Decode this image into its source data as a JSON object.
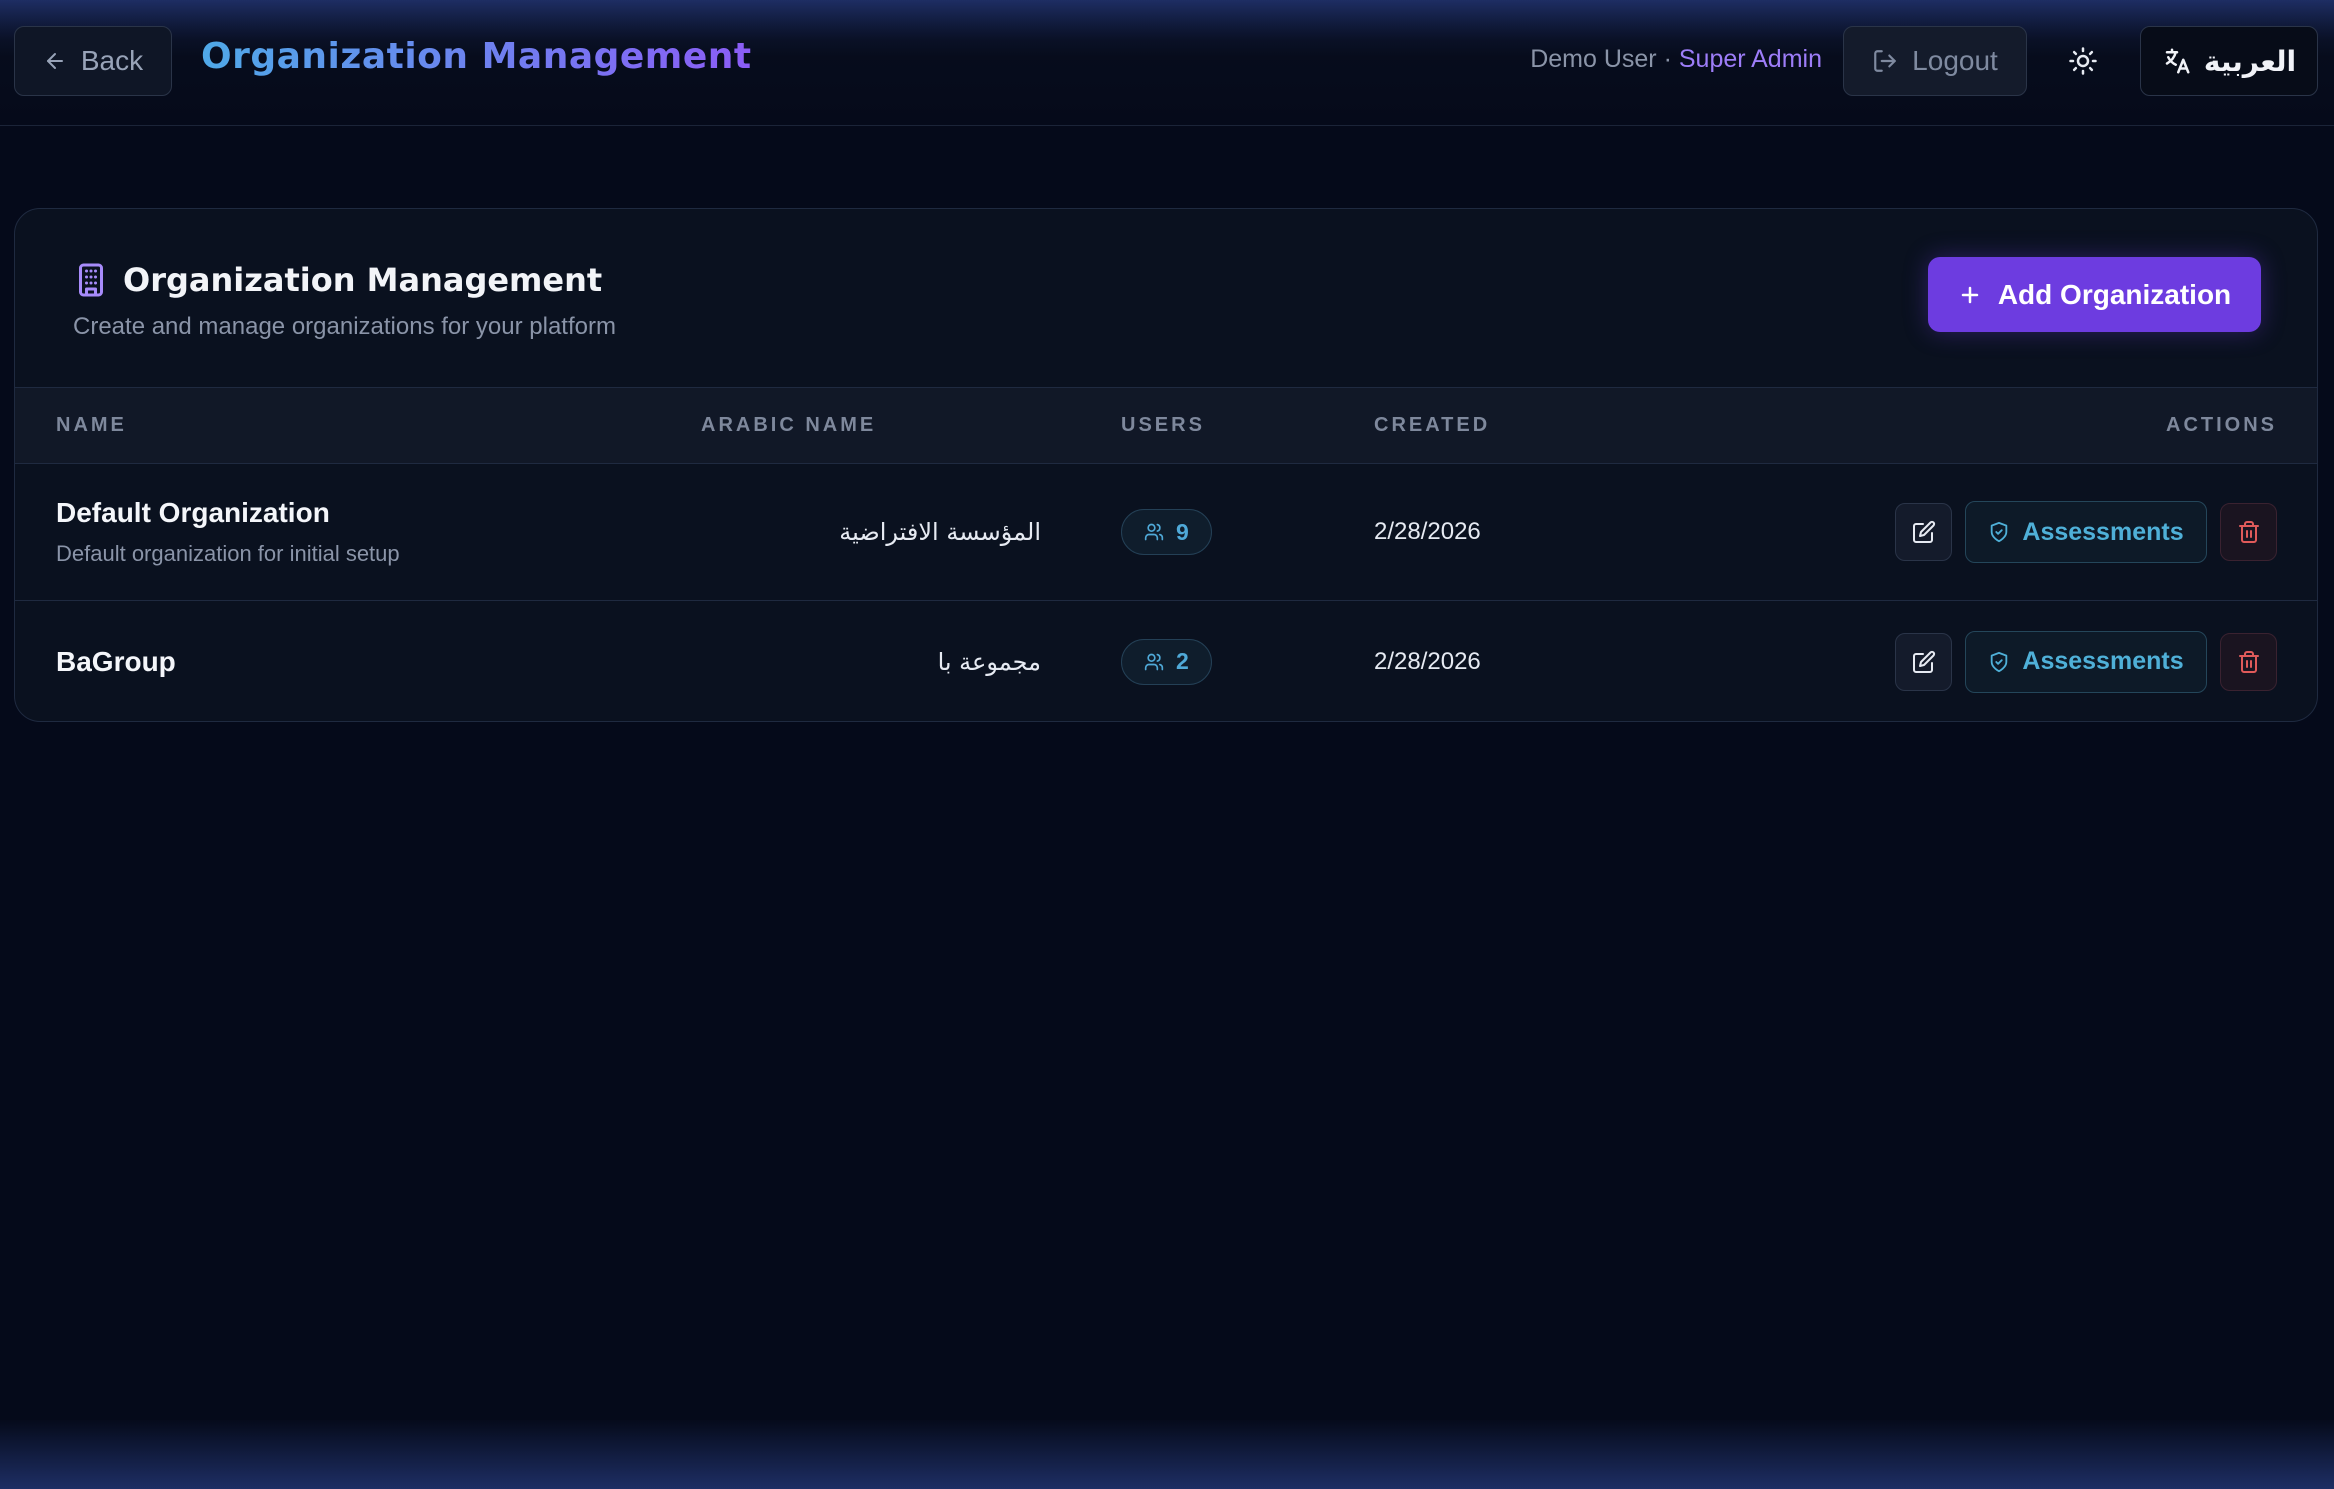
{
  "header": {
    "back_label": "Back",
    "title": "Organization Management",
    "user_name": "Demo User",
    "separator": " · ",
    "user_role": "Super Admin",
    "logout_label": "Logout",
    "language_label": "العربية"
  },
  "card": {
    "title": "Organization Management",
    "subtitle": "Create and manage organizations for your platform",
    "add_button_label": "Add Organization"
  },
  "table": {
    "columns": {
      "name": "NAME",
      "arabic_name": "ARABIC NAME",
      "users": "USERS",
      "created": "CREATED",
      "actions": "ACTIONS"
    },
    "rows": [
      {
        "name": "Default Organization",
        "description": "Default organization for initial setup",
        "arabic_name": "المؤسسة الافتراضية",
        "users": "9",
        "created": "2/28/2026",
        "assessments_label": "Assessments"
      },
      {
        "name": "BaGroup",
        "description": "",
        "arabic_name": "مجموعة با",
        "users": "2",
        "created": "2/28/2026",
        "assessments_label": "Assessments"
      }
    ]
  },
  "colors": {
    "background": "#050a1a",
    "accent_purple": "#6d3ce0",
    "accent_cyan": "#4fa9d8",
    "danger": "#e05a5a",
    "title_gradient_start": "#4fa9e8",
    "title_gradient_end": "#8b5cf6"
  },
  "icons": {
    "back": "arrow-left-icon",
    "logout": "logout-icon",
    "theme": "sun-icon",
    "language": "translate-icon",
    "card": "building-icon",
    "add": "plus-icon",
    "users": "users-icon",
    "edit": "edit-icon",
    "assessments": "shield-icon",
    "delete": "trash-icon"
  }
}
